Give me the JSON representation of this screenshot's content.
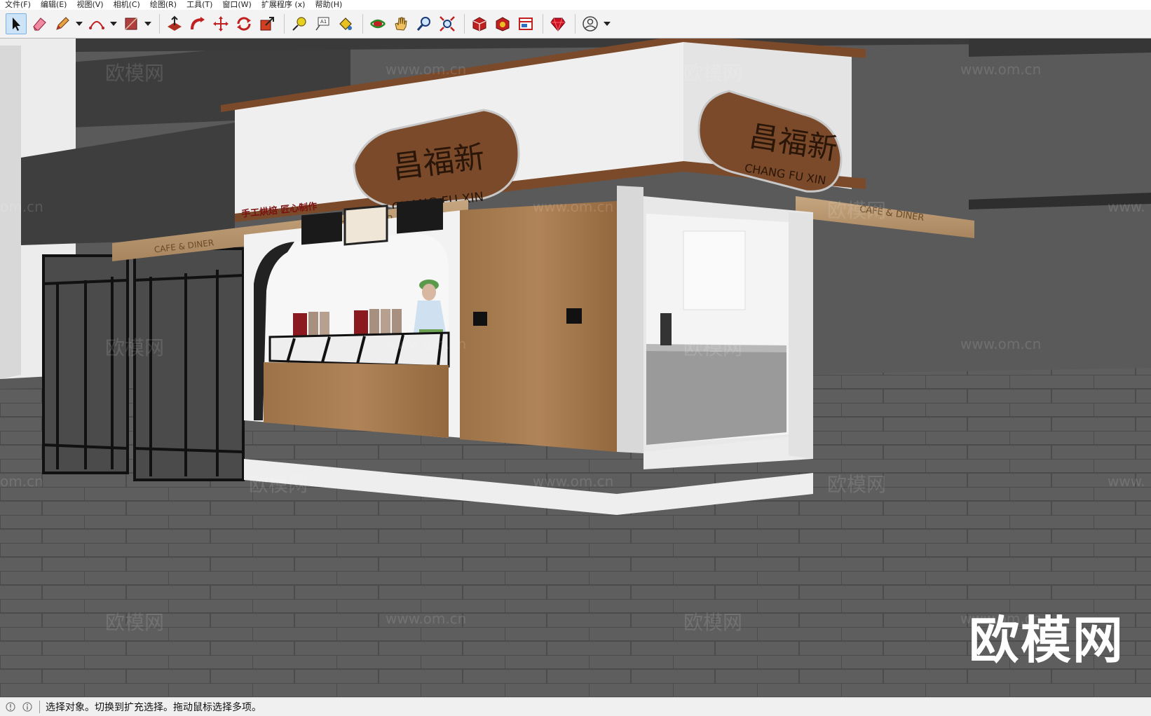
{
  "menu": {
    "file": "文件(F)",
    "edit": "编辑(E)",
    "view": "视图(V)",
    "camera": "相机(C)",
    "draw": "绘图(R)",
    "tools": "工具(T)",
    "window": "窗口(W)",
    "extensions": "扩展程序 (x)",
    "help": "帮助(H)"
  },
  "toolbar": {
    "icons": [
      "select-icon",
      "eraser-icon",
      "pencil-icon",
      "arc-icon",
      "shape-icon",
      "push-pull-icon",
      "follow-me-icon",
      "move-icon",
      "rotate-icon",
      "scale-icon",
      "tape-measure-icon",
      "text-icon",
      "paint-bucket-icon",
      "orbit-icon",
      "pan-icon",
      "zoom-icon",
      "zoom-extents-icon",
      "warehouse-icon",
      "extension-warehouse-icon",
      "layout-icon",
      "ruby-icon",
      "account-icon"
    ],
    "accent": "#cde3f7"
  },
  "scene": {
    "sign_main": "昌福新",
    "sign_sub": "CHANG FU XIN",
    "awning_text": "CAFE & DINER",
    "slogan": "手工烘焙 匠心制作",
    "wood_color": "#7a4a2a",
    "floor_color": "#5e5e5e"
  },
  "watermark": {
    "cn": "欧模网",
    "url": "www.om.cn",
    "url_partial_left": "om.cn",
    "url_partial_right": "www.",
    "big": "欧模网"
  },
  "status": {
    "message": "选择对象。切换到扩充选择。拖动鼠标选择多项。"
  }
}
